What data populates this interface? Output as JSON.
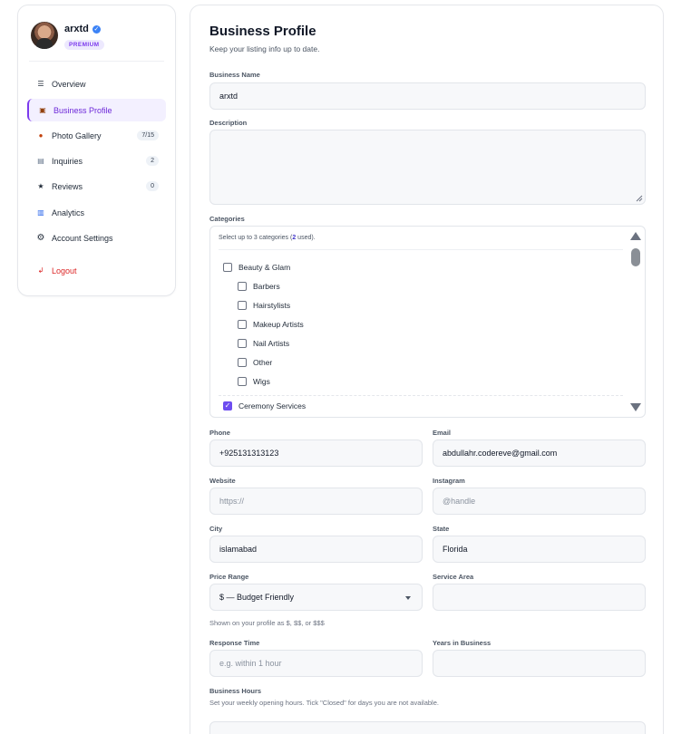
{
  "sidebar": {
    "username": "arxtd",
    "badge": "PREMIUM",
    "items": [
      {
        "label": "Overview",
        "icon": "list-icon"
      },
      {
        "label": "Business Profile",
        "icon": "briefcase-icon"
      },
      {
        "label": "Photo Gallery",
        "icon": "photo-icon",
        "count": "7/15"
      },
      {
        "label": "Inquiries",
        "icon": "inbox-icon",
        "count": "2"
      },
      {
        "label": "Reviews",
        "icon": "star-icon",
        "count": "0"
      },
      {
        "label": "Analytics",
        "icon": "chart-icon"
      },
      {
        "label": "Account Settings",
        "icon": "gear-icon"
      },
      {
        "label": "Logout",
        "icon": "logout-icon"
      }
    ],
    "accent_color": "#7c3aed"
  },
  "form": {
    "title": "Business Profile",
    "subtitle": "Keep your listing info up to date.",
    "business_name": {
      "label": "Business Name",
      "value": "arxtd"
    },
    "description": {
      "label": "Description",
      "value": ""
    },
    "categories": {
      "label": "Categories",
      "hint_prefix": "Select up to 3 categories (",
      "hint_count": "2",
      "hint_suffix": " used).",
      "items": [
        {
          "label": "Beauty & Glam",
          "checked": false
        },
        {
          "label": "Barbers",
          "checked": false
        },
        {
          "label": "Hairstylists",
          "checked": false
        },
        {
          "label": "Makeup Artists",
          "checked": false
        },
        {
          "label": "Nail Artists",
          "checked": false
        },
        {
          "label": "Other",
          "checked": false
        },
        {
          "label": "Wigs",
          "checked": false
        },
        {
          "label": "Ceremony Services",
          "checked": true
        }
      ]
    },
    "phone": {
      "label": "Phone",
      "value": "+925131313123"
    },
    "email": {
      "label": "Email",
      "value": "abdullahr.codereve@gmail.com"
    },
    "website": {
      "label": "Website",
      "placeholder": "https://"
    },
    "instagram": {
      "label": "Instagram",
      "placeholder": "@handle"
    },
    "city": {
      "label": "City",
      "value": "islamabad"
    },
    "state": {
      "label": "State",
      "value": "Florida"
    },
    "price_range": {
      "label": "Price Range",
      "value": "$ — Budget Friendly",
      "hint": "Shown on your profile as $, $$, or $$$"
    },
    "service_area": {
      "label": "Service Area",
      "value": ""
    },
    "response_time": {
      "label": "Response Time",
      "placeholder": "e.g. within 1 hour"
    },
    "years_in_business": {
      "label": "Years in Business",
      "value": ""
    },
    "business_hours": {
      "label": "Business Hours",
      "hint": "Set your weekly opening hours. Tick \"Closed\" for days you are not available."
    }
  }
}
